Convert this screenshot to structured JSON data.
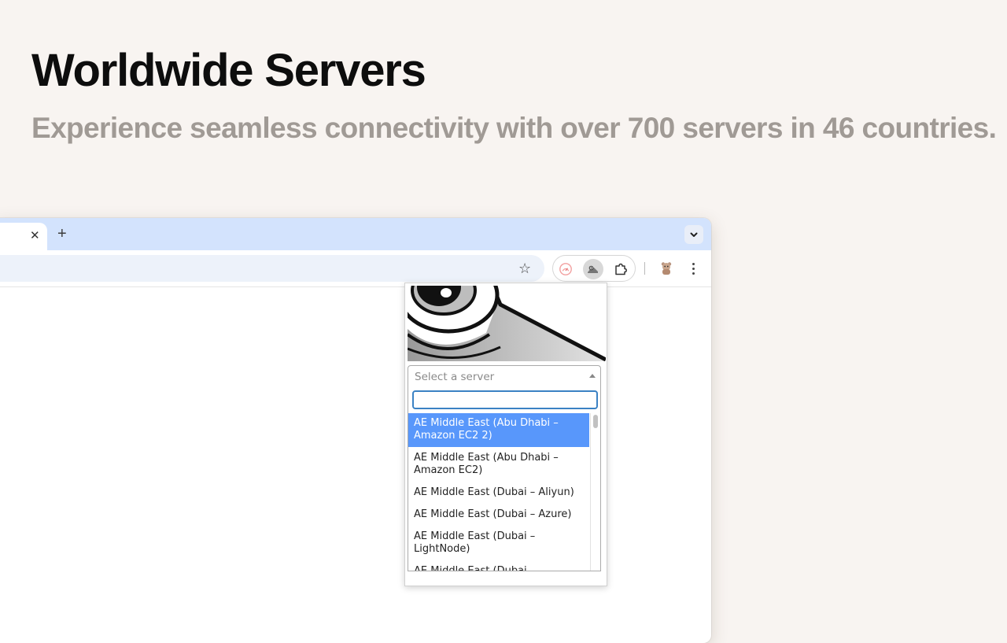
{
  "headline": "Worldwide Servers",
  "subheadline": "Experience seamless connectivity with over 700 servers in 46 countries.",
  "browser": {
    "tab_close": "✕",
    "new_tab": "+",
    "bookmark_star": "☆",
    "icons": [
      "close-icon",
      "plus-icon",
      "chevron-down-icon",
      "star-icon",
      "speedometer-icon",
      "mascot-extension-icon",
      "puzzle-icon",
      "avatar",
      "more-icon"
    ]
  },
  "popup": {
    "select_placeholder": "Select a server",
    "search_value": "",
    "options": [
      "AE Middle East (Abu Dhabi – Amazon EC2 2)",
      "AE Middle East (Abu Dhabi – Amazon EC2)",
      "AE Middle East (Dubai – Aliyun)",
      "AE Middle East (Dubai – Azure)",
      "AE Middle East (Dubai – LightNode)",
      "AE Middle East (Dubai –"
    ],
    "highlight_color": "#5897fb"
  }
}
